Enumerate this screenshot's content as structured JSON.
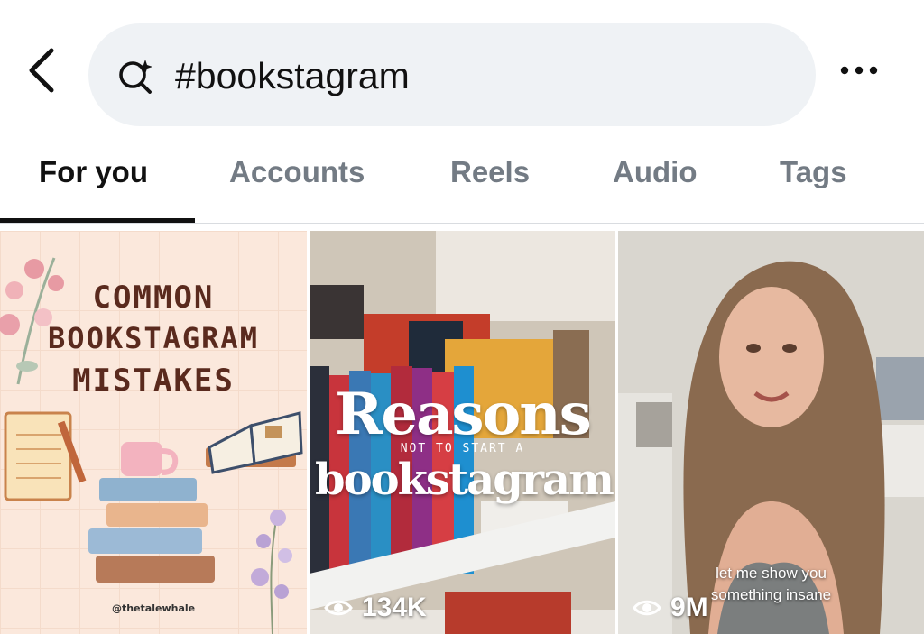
{
  "header": {
    "back_icon": "chevron-left-icon",
    "search_icon": "search-sparkle-icon",
    "search_value": "#bookstagram",
    "more_icon": "more-horizontal-icon"
  },
  "tabs": [
    {
      "label": "For you",
      "active": true
    },
    {
      "label": "Accounts",
      "active": false
    },
    {
      "label": "Reels",
      "active": false
    },
    {
      "label": "Audio",
      "active": false
    },
    {
      "label": "Tags",
      "active": false
    }
  ],
  "results": [
    {
      "title_lines": [
        "COMMON",
        "BOOKSTAGRAM",
        "MISTAKES"
      ],
      "handle": "@thetalewhale"
    },
    {
      "title_big": "Reasons",
      "subtitle": "NOT TO START A",
      "title_word": "bookstagram",
      "views": "134K",
      "view_icon": "eye-icon"
    },
    {
      "caption_lines": [
        "let me show you",
        "something insane"
      ],
      "views": "9M",
      "view_icon": "eye-icon"
    }
  ],
  "colors": {
    "accent": "#111111",
    "tab_inactive": "#737b84",
    "search_bg": "#eff2f5"
  }
}
